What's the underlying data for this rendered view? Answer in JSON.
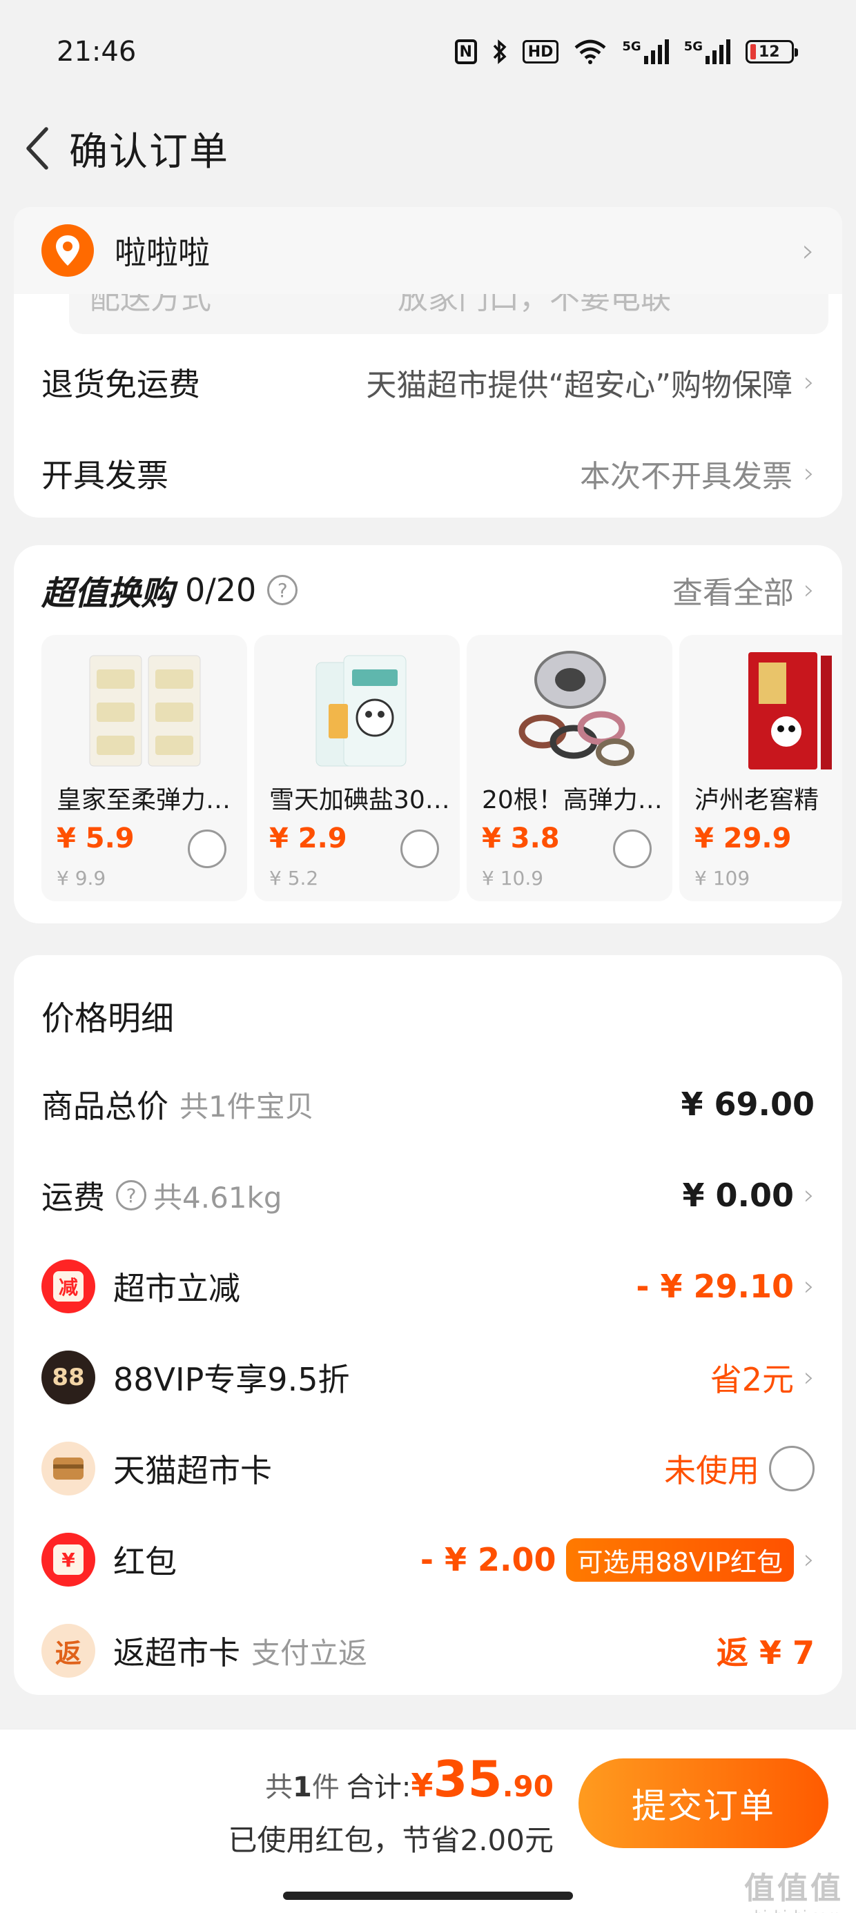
{
  "status": {
    "time": "21:46",
    "nfc": "N",
    "hd": "HD",
    "net1": "5G",
    "net2": "5G",
    "battery": "12"
  },
  "nav": {
    "title": "确认订单"
  },
  "address": {
    "name": "啦啦啦"
  },
  "peek_row": {
    "left": "配送方式",
    "right": "放家门口，不要电联"
  },
  "info_rows": [
    {
      "label": "退货免运费",
      "value": "天猫超市提供“超安心”购物保障"
    },
    {
      "label": "开具发票",
      "value": "本次不开具发票"
    }
  ],
  "exchange": {
    "title": "超值换购",
    "count": "0/20",
    "view_all": "查看全部",
    "products": [
      {
        "name": "皇家至柔弹力…",
        "price": "¥ 5.9",
        "orig": "¥ 9.9"
      },
      {
        "name": "雪天加碘盐30…",
        "price": "¥ 2.9",
        "orig": "¥ 5.2"
      },
      {
        "name": "20根！高弹力…",
        "price": "¥ 3.8",
        "orig": "¥ 10.9"
      },
      {
        "name": "泸州老窖精",
        "price": "¥ 29.9",
        "orig": "¥ 109"
      }
    ]
  },
  "price_detail": {
    "title": "价格明细",
    "goods_total_label": "商品总价",
    "goods_total_sub": "共1件宝贝",
    "goods_total_value": "¥ 69.00",
    "shipping_label": "运费",
    "shipping_sub": "共4.61kg",
    "shipping_value": "¥ 0.00",
    "market_off_icon": "减",
    "market_off_label": "超市立减",
    "market_off_value": "- ¥ 29.10",
    "vip_icon": "88",
    "vip_label": "88VIP专享9.5折",
    "vip_value": "省2元",
    "card_label": "天猫超市卡",
    "card_value": "未使用",
    "redpacket_icon": "¥",
    "redpacket_label": "红包",
    "redpacket_value": "- ¥ 2.00",
    "redpacket_tag": "可选用88VIP红包",
    "rebate_icon": "返",
    "rebate_label": "返超市卡",
    "rebate_sub": "支付立返",
    "rebate_value": "返 ¥ 7"
  },
  "footer": {
    "count_prefix": "共",
    "count_num": "1",
    "count_suffix": "件",
    "total_label": "合计:",
    "yen": "¥",
    "total_int": "35",
    "total_dec": ".90",
    "saved": "已使用红包，节省2.00元",
    "submit": "提交订单"
  },
  "watermark": {
    "title": "值值值",
    "sub": "zhizhizhi.com"
  },
  "colors": {
    "accent": "#ff5000",
    "submit_from": "#ff9b1f",
    "submit_to": "#ff5b00",
    "pin": "#ff6a00"
  }
}
